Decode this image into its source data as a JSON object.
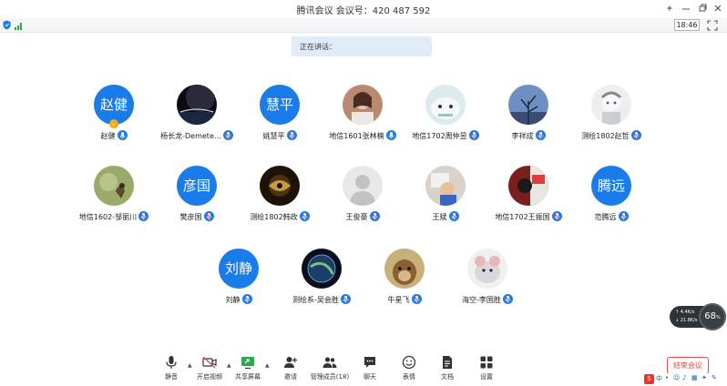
{
  "window": {
    "title": "腾讯会议  会议号：420 487 592"
  },
  "status": {
    "time": "18:46"
  },
  "speaking": {
    "label": "正在讲话："
  },
  "participants": [
    {
      "name": "赵健",
      "avatar_text": "赵健",
      "mic": "on",
      "raised_hand": true
    },
    {
      "name": "杨长龙-Demete…",
      "avatar_text": "",
      "mic": "off"
    },
    {
      "name": "姚慧平",
      "avatar_text": "慧平",
      "mic": "off"
    },
    {
      "name": "地信1601张林楠",
      "avatar_text": "",
      "mic": "on"
    },
    {
      "name": "地信1702周仲昱",
      "avatar_text": "",
      "mic": "off"
    },
    {
      "name": "李祥成",
      "avatar_text": "",
      "mic": "off"
    },
    {
      "name": "测绘1802赵哲",
      "avatar_text": "",
      "mic": "off"
    },
    {
      "name": "地信1602-邹丽川",
      "avatar_text": "",
      "mic": "off"
    },
    {
      "name": "樊彦国",
      "avatar_text": "彦国",
      "mic": "off"
    },
    {
      "name": "测绘1802韩政",
      "avatar_text": "",
      "mic": "off"
    },
    {
      "name": "王俊豪",
      "avatar_text": "",
      "mic": "off"
    },
    {
      "name": "王斌",
      "avatar_text": "",
      "mic": "off"
    },
    {
      "name": "地信1702王振国",
      "avatar_text": "",
      "mic": "off"
    },
    {
      "name": "范腾远",
      "avatar_text": "腾远",
      "mic": "off"
    },
    {
      "name": "刘静",
      "avatar_text": "刘静",
      "mic": "off"
    },
    {
      "name": "测绘系-吴会胜",
      "avatar_text": "",
      "mic": "off"
    },
    {
      "name": "牛星飞",
      "avatar_text": "",
      "mic": "off"
    },
    {
      "name": "海空-李国胜",
      "avatar_text": "",
      "mic": "off"
    }
  ],
  "network": {
    "upload": "4.4K/s",
    "download": "21.8K/s",
    "quality": "68",
    "unit": "%"
  },
  "toolbar": {
    "mute": "静音",
    "video": "开启视频",
    "share": "共享屏幕",
    "invite": "邀请",
    "members": "管理成员(18)",
    "chat": "聊天",
    "reactions": "表情",
    "docs": "文档",
    "settings": "设置",
    "end": "结束会议"
  },
  "ime": {
    "mode": "中"
  },
  "colors": {
    "accent": "#1a7ce8",
    "danger": "#e14b4b"
  }
}
